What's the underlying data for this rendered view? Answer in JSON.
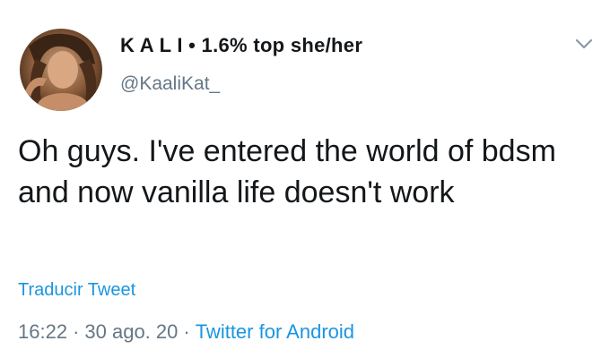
{
  "tweet": {
    "display_name": "K A L I • 1.6% top she/her",
    "handle": "@KaaliKat_",
    "text": "Oh guys. I've entered the world of bdsm and now vanilla life doesn't work",
    "translate_label": "Traducir Tweet",
    "time": "16:22",
    "date": "30 ago. 20",
    "separator": "·",
    "source": "Twitter for Android"
  },
  "icons": {
    "avatar": "avatar-photo",
    "menu": "chevron-down-icon"
  },
  "colors": {
    "link": "#1b95e0",
    "secondary_text": "#657786",
    "primary_text": "#14171a"
  }
}
